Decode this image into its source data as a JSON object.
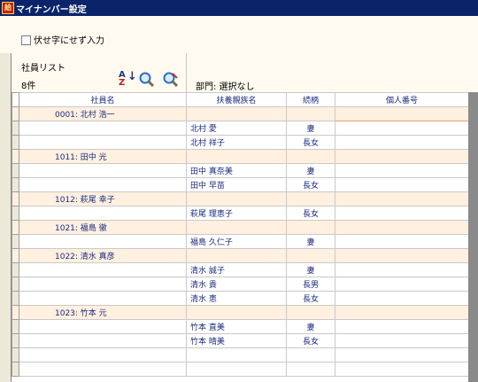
{
  "window": {
    "title": "マイナンバー設定",
    "icon_label": "給"
  },
  "options": {
    "mask_label": "伏せ字にせず入力"
  },
  "list_header": {
    "title": "社員リスト",
    "count": "8件",
    "dept_label": "部門: 選択なし"
  },
  "icons": {
    "sort": "sort-az-icon",
    "zoom_in": "zoom-in-icon",
    "zoom_out": "zoom-out-icon"
  },
  "columns": [
    "社員名",
    "扶養親族名",
    "続柄",
    "個人番号"
  ],
  "rows": [
    {
      "type": "emp",
      "employee": "0001: 北村 浩一",
      "family": "",
      "relation": "",
      "number": ""
    },
    {
      "type": "fam",
      "employee": "",
      "family": "北村 愛",
      "relation": "妻",
      "number": ""
    },
    {
      "type": "fam",
      "employee": "",
      "family": "北村 祥子",
      "relation": "長女",
      "number": ""
    },
    {
      "type": "emp",
      "employee": "1011: 田中 光",
      "family": "",
      "relation": "",
      "number": ""
    },
    {
      "type": "fam",
      "employee": "",
      "family": "田中 真奈美",
      "relation": "妻",
      "number": ""
    },
    {
      "type": "fam",
      "employee": "",
      "family": "田中 早苗",
      "relation": "長女",
      "number": ""
    },
    {
      "type": "emp",
      "employee": "1012: 萩尾 幸子",
      "family": "",
      "relation": "",
      "number": ""
    },
    {
      "type": "fam",
      "employee": "",
      "family": "萩尾 理恵子",
      "relation": "長女",
      "number": ""
    },
    {
      "type": "emp",
      "employee": "1021: 福島 徹",
      "family": "",
      "relation": "",
      "number": ""
    },
    {
      "type": "fam",
      "employee": "",
      "family": "福島 久仁子",
      "relation": "妻",
      "number": ""
    },
    {
      "type": "emp",
      "employee": "1022: 清水 真彦",
      "family": "",
      "relation": "",
      "number": ""
    },
    {
      "type": "fam",
      "employee": "",
      "family": "清水 誠子",
      "relation": "妻",
      "number": ""
    },
    {
      "type": "fam",
      "employee": "",
      "family": "清水 貴",
      "relation": "長男",
      "number": ""
    },
    {
      "type": "fam",
      "employee": "",
      "family": "清水 恵",
      "relation": "長女",
      "number": ""
    },
    {
      "type": "emp",
      "employee": "1023: 竹本 元",
      "family": "",
      "relation": "",
      "number": ""
    },
    {
      "type": "fam",
      "employee": "",
      "family": "竹本 直美",
      "relation": "妻",
      "number": ""
    },
    {
      "type": "fam",
      "employee": "",
      "family": "竹本 晴美",
      "relation": "長女",
      "number": ""
    },
    {
      "type": "blank",
      "employee": "",
      "family": "",
      "relation": "",
      "number": ""
    },
    {
      "type": "blank",
      "employee": "",
      "family": "",
      "relation": "",
      "number": ""
    }
  ]
}
